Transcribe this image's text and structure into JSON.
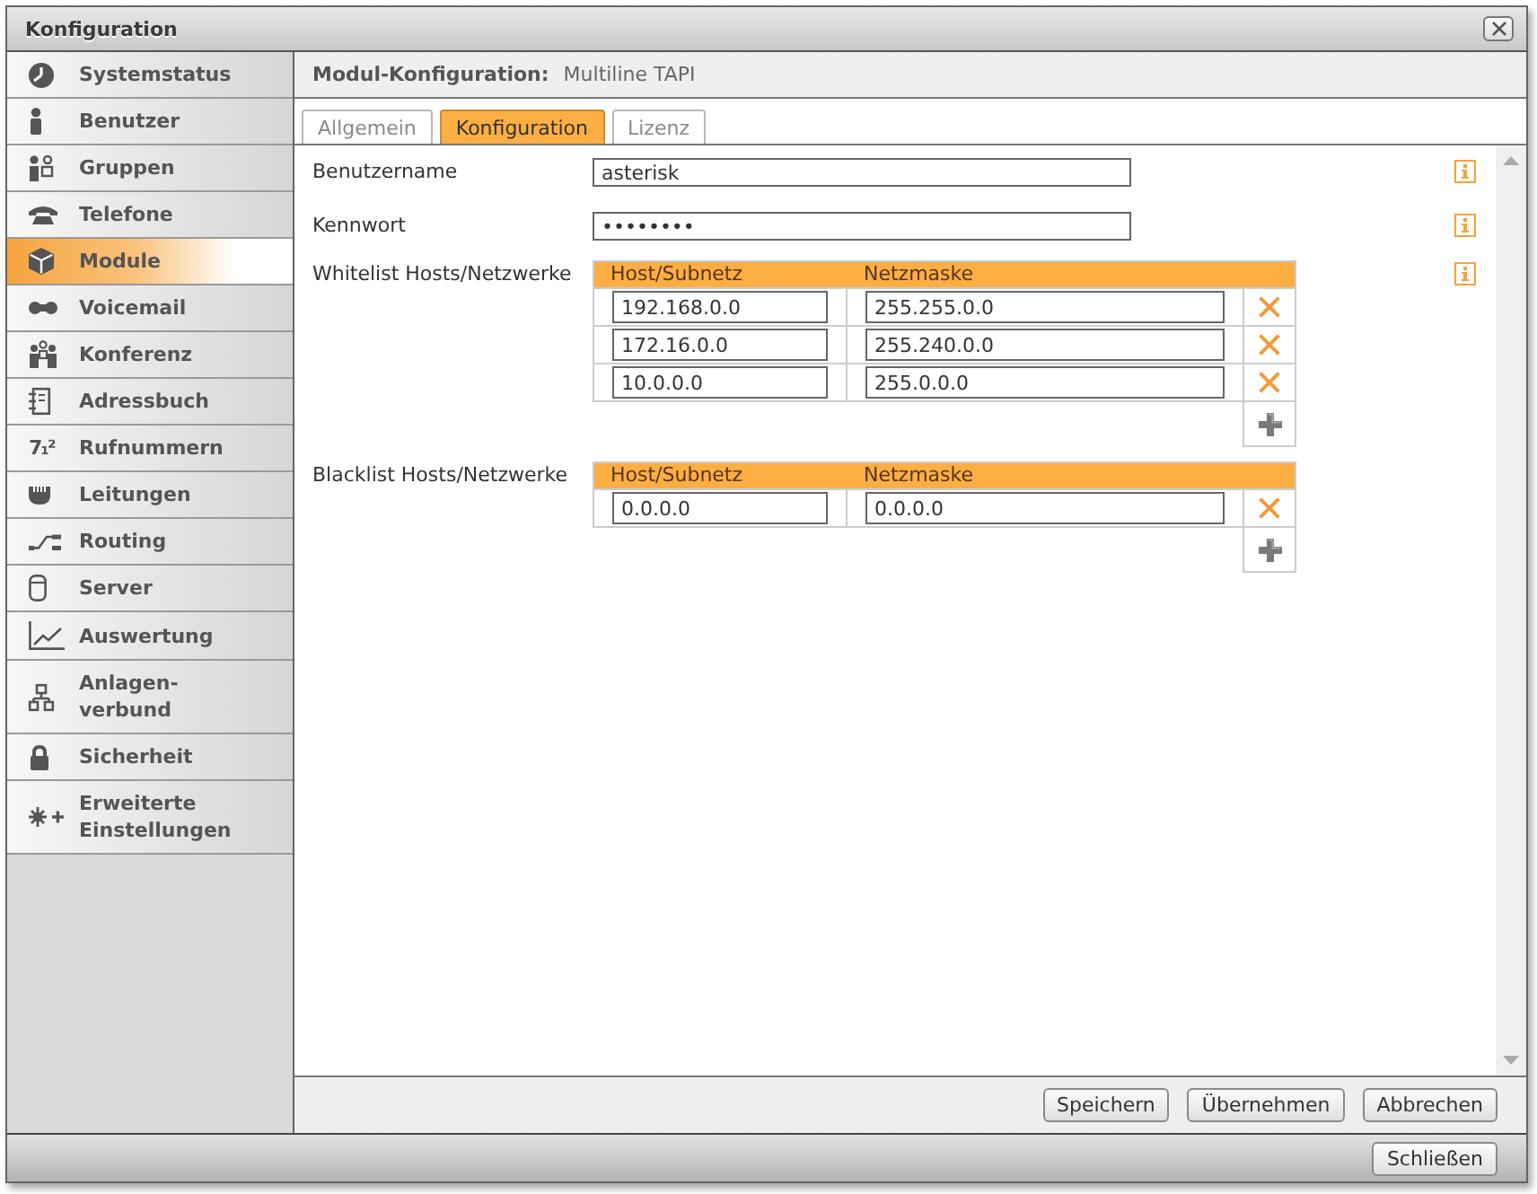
{
  "window": {
    "title": "Konfiguration"
  },
  "sidebar": {
    "items": [
      {
        "label": "Systemstatus",
        "selected": false
      },
      {
        "label": "Benutzer",
        "selected": false
      },
      {
        "label": "Gruppen",
        "selected": false
      },
      {
        "label": "Telefone",
        "selected": false
      },
      {
        "label": "Module",
        "selected": true
      },
      {
        "label": "Voicemail",
        "selected": false
      },
      {
        "label": "Konferenz",
        "selected": false
      },
      {
        "label": "Adressbuch",
        "selected": false
      },
      {
        "label": "Rufnummern",
        "selected": false,
        "icon_text": "7₁²"
      },
      {
        "label": "Leitungen",
        "selected": false
      },
      {
        "label": "Routing",
        "selected": false
      },
      {
        "label": "Server",
        "selected": false
      },
      {
        "label": "Auswertung",
        "selected": false
      },
      {
        "label": "Anlagen-verbund",
        "selected": false
      },
      {
        "label": "Sicherheit",
        "selected": false
      },
      {
        "label": "Erweiterte Einstellungen",
        "selected": false
      }
    ]
  },
  "module_header": {
    "label": "Modul-Konfiguration:",
    "value": "Multiline TAPI"
  },
  "tabs": [
    {
      "label": "Allgemein",
      "selected": false
    },
    {
      "label": "Konfiguration",
      "selected": true
    },
    {
      "label": "Lizenz",
      "selected": false
    }
  ],
  "form": {
    "rows": [
      {
        "kind": "field",
        "label": "Benutzername",
        "value": "asterisk",
        "info": true
      },
      {
        "kind": "field",
        "label": "Kennwort",
        "value": "••••••••",
        "info": true
      },
      {
        "kind": "table",
        "label": "Whitelist Hosts/Netzwerke",
        "columns": [
          "Host/Subnetz",
          "Netzmaske"
        ],
        "rows": [
          {
            "host": "192.168.0.0",
            "netmask": "255.255.0.0"
          },
          {
            "host": "172.16.0.0",
            "netmask": "255.240.0.0"
          },
          {
            "host": "10.0.0.0",
            "netmask": "255.0.0.0"
          }
        ],
        "info": true
      },
      {
        "kind": "table",
        "label": "Blacklist Hosts/Netzwerke",
        "columns": [
          "Host/Subnetz",
          "Netzmaske"
        ],
        "rows": [
          {
            "host": "0.0.0.0",
            "netmask": "0.0.0.0"
          }
        ],
        "info": false
      }
    ]
  },
  "buttons": [
    "Speichern",
    "Übernehmen",
    "Abbrechen"
  ],
  "close_button": "Schließen"
}
